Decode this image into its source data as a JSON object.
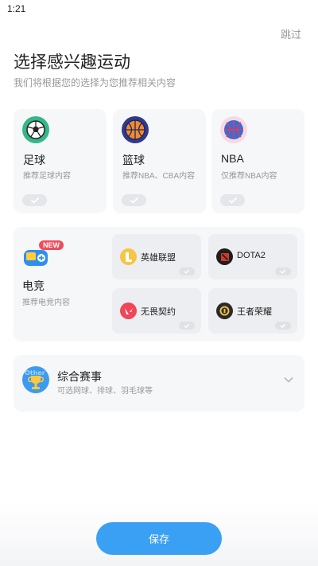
{
  "status_bar": {
    "time": "1:21"
  },
  "header": {
    "skip_label": "跳过",
    "title": "选择感兴趣运动",
    "subtitle": "我们将根据您的选择为您推荐相关内容"
  },
  "sports": [
    {
      "name": "足球",
      "desc": "推荐足球内容",
      "icon": "soccer-ball-icon",
      "selected": false
    },
    {
      "name": "篮球",
      "desc": "推荐NBA、CBA内容",
      "icon": "basketball-icon",
      "selected": false
    },
    {
      "name": "NBA",
      "desc": "仅推荐NBA内容",
      "icon": "nba-ball-icon",
      "selected": false
    }
  ],
  "esports": {
    "badge": "NEW",
    "name": "电竞",
    "desc": "推荐电竞内容",
    "icon": "gamepad-icon",
    "games": [
      {
        "name": "英雄联盟",
        "icon": "league-of-legends-icon"
      },
      {
        "name": "DOTA2",
        "icon": "dota2-icon"
      },
      {
        "name": "无畏契约",
        "icon": "valorant-icon"
      },
      {
        "name": "王者荣耀",
        "icon": "honor-of-kings-icon"
      }
    ]
  },
  "general": {
    "name": "综合赛事",
    "desc": "可选网球、排球、羽毛球等",
    "icon": "trophy-icon",
    "icon_text": "Other"
  },
  "footer": {
    "save_label": "保存"
  },
  "colors": {
    "accent": "#3aa0f3",
    "badge": "#f24b5a"
  }
}
